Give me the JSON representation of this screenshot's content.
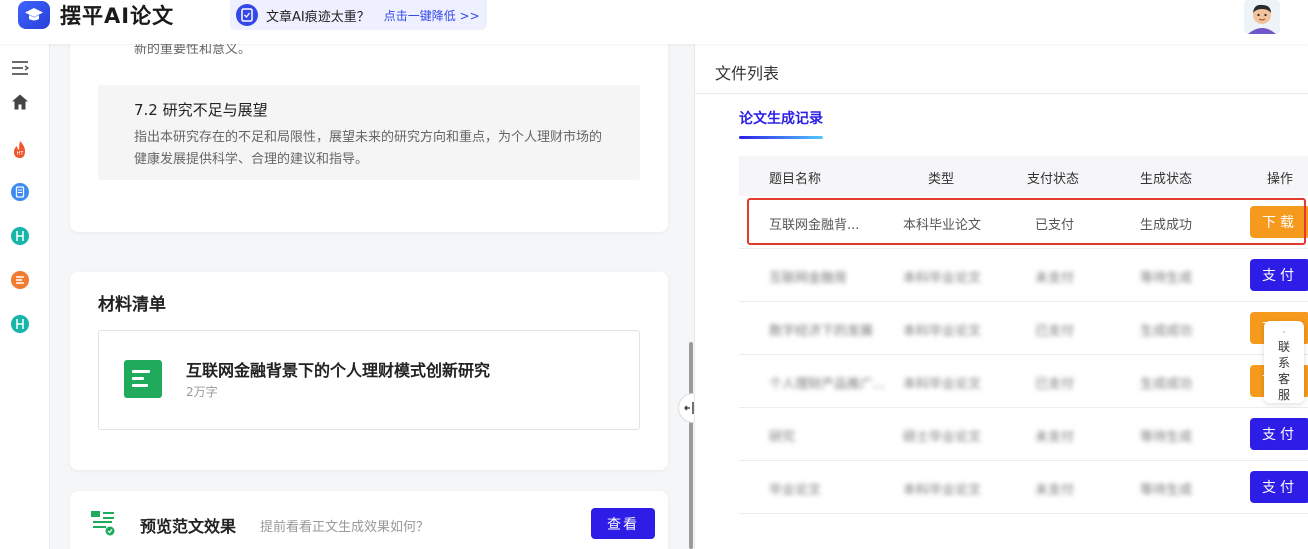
{
  "app": {
    "name": "摆平AI论文"
  },
  "promo": {
    "text": "文章AI痕迹太重？",
    "link": "点击一键降低 >>"
  },
  "outline": {
    "prev_text": "新的重要性和意义。",
    "section_title": "7.2 研究不足与展望",
    "section_desc": "指出本研究存在的不足和局限性，展望未来的研究方向和重点，为个人理财市场的健康发展提供科学、合理的建议和指导。"
  },
  "materials": {
    "title": "材料清单",
    "item": {
      "title": "互联网金融背景下的个人理财模式创新研究",
      "meta": "2万字"
    }
  },
  "preview": {
    "title": "预览范文效果",
    "hint": "提前看看正文生成效果如何？",
    "button": "查看"
  },
  "file_panel": {
    "title": "文件列表",
    "tab": "论文生成记录",
    "columns": [
      "题目名称",
      "类型",
      "支付状态",
      "生成状态",
      "操作"
    ],
    "rows": [
      {
        "name": "互联网金融背...",
        "type": "本科毕业论文",
        "pay": "已支付",
        "gen": "生成成功",
        "action": "下载",
        "action_color": "#f59a1c",
        "blurred": false
      },
      {
        "name": "互联网金融背",
        "type": "本科毕业论文",
        "pay": "未支付",
        "gen": "等待生成",
        "action": "支付",
        "action_color": "#2e1de6",
        "blurred": true
      },
      {
        "name": "数字经济下的发展",
        "type": "本科毕业论文",
        "pay": "已支付",
        "gen": "生成成功",
        "action": "下载",
        "action_color": "#f59a1c",
        "blurred": true
      },
      {
        "name": "个人理财产品推广...",
        "type": "本科毕业论文",
        "pay": "已支付",
        "gen": "生成成功",
        "action": "下载",
        "action_color": "#f59a1c",
        "blurred": true
      },
      {
        "name": "研究",
        "type": "硕士毕业论文",
        "pay": "未支付",
        "gen": "等待生成",
        "action": "支付",
        "action_color": "#2e1de6",
        "blurred": true
      },
      {
        "name": "毕业论文",
        "type": "本科毕业论文",
        "pay": "未支付",
        "gen": "等待生成",
        "action": "支付",
        "action_color": "#2e1de6",
        "blurred": true
      }
    ]
  },
  "contact": {
    "label": "联系客服"
  },
  "colors": {
    "accent": "#2e1de6",
    "download": "#f59a1c",
    "highlight": "#e43a2e"
  }
}
